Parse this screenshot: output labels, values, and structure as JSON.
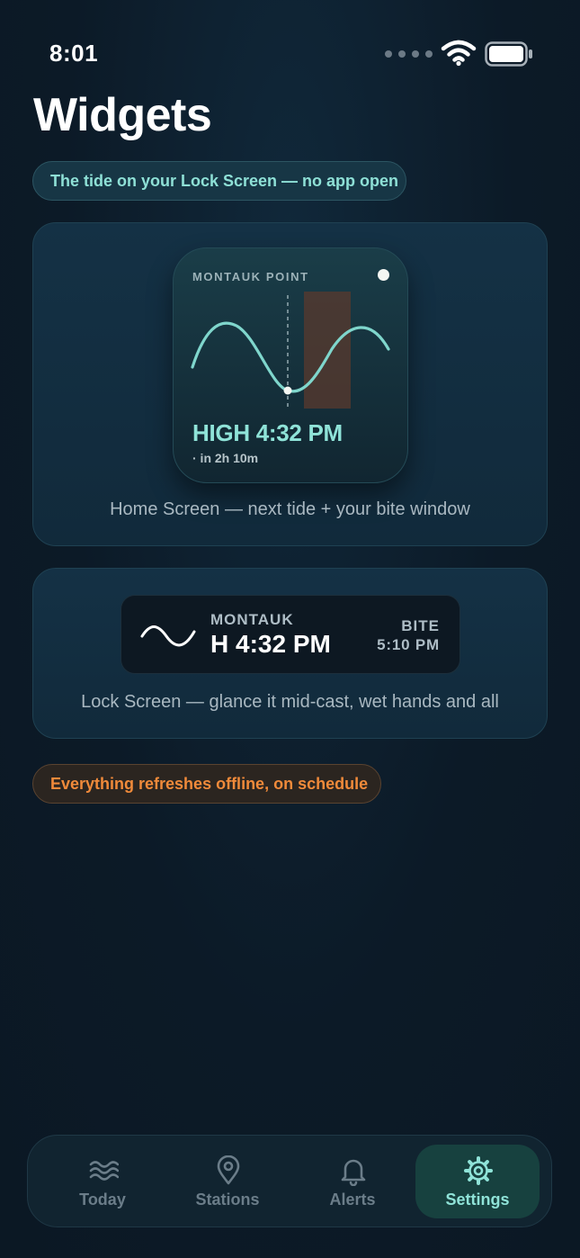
{
  "status_bar": {
    "time": "8:01",
    "icons": [
      "signal-dots-icon",
      "wifi-icon",
      "battery-icon"
    ]
  },
  "page": {
    "title": "Widgets",
    "tagline": "The tide on your Lock Screen — no app open",
    "footer_note": "Everything refreshes offline, on schedule"
  },
  "home_widget": {
    "station": "MONTAUK POINT",
    "tide": "HIGH 4:32 PM",
    "countdown": "· in 2h 10m",
    "caption": "Home Screen — next tide + your bite window",
    "icons": [
      "moon-icon",
      "tide-curve"
    ]
  },
  "lock_widget": {
    "station": "MONTAUK",
    "tide": "H 4:32 PM",
    "bite_label": "BITE",
    "bite_time": "5:10 PM",
    "caption": "Lock Screen — glance it mid-cast, wet hands and all",
    "icons": [
      "wave-icon"
    ]
  },
  "tab_bar": {
    "active": "Settings",
    "tabs": [
      {
        "label": "Today",
        "icon": "waves-icon"
      },
      {
        "label": "Stations",
        "icon": "map-pin-icon"
      },
      {
        "label": "Alerts",
        "icon": "bell-icon"
      },
      {
        "label": "Settings",
        "icon": "gear-icon"
      }
    ]
  },
  "colors": {
    "background": "#0c1a27",
    "accent_teal": "#8fe3d8",
    "accent_orange": "#f08a3a",
    "bite_window": "#5a3a2e"
  }
}
